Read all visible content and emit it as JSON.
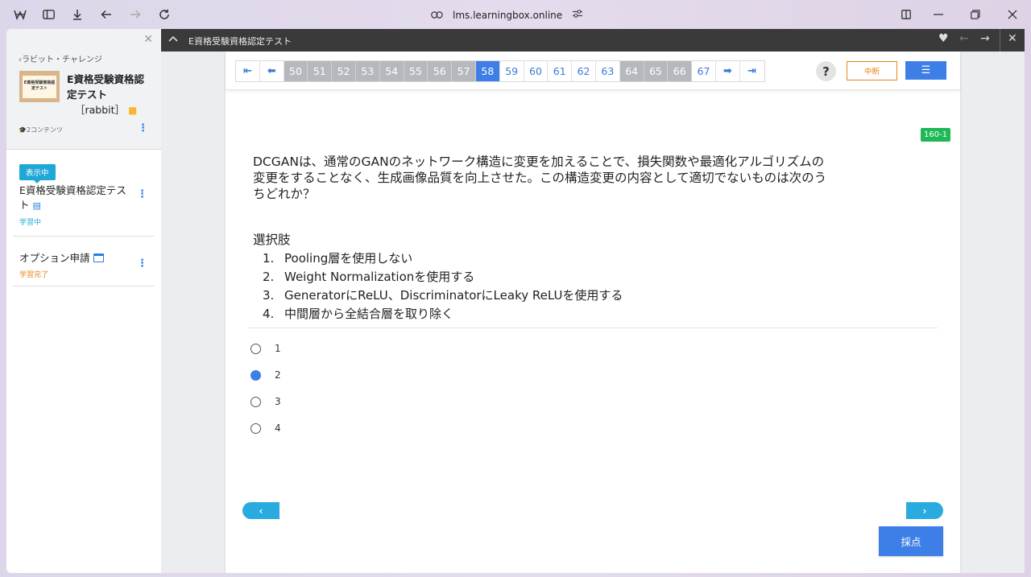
{
  "browser": {
    "url": "lms.learningbox.online"
  },
  "sidebar": {
    "back_link": "ラビット・チャレンジ",
    "thumbnail_text": "E資格受験資格認定テスト",
    "course_title": "E資格受験資格認定テスト",
    "course_tag": "［rabbit］",
    "content_count": "2コンテンツ",
    "current_badge": "表示中",
    "items": [
      {
        "title": "E資格受験資格認定テスト",
        "status": "学習中"
      },
      {
        "title": "オプション申請",
        "status": "学習完了"
      }
    ]
  },
  "topbar": {
    "title": "E資格受験資格認定テスト"
  },
  "pager": {
    "pages": [
      {
        "label": "50",
        "state": "answered"
      },
      {
        "label": "51",
        "state": "answered"
      },
      {
        "label": "52",
        "state": "answered"
      },
      {
        "label": "53",
        "state": "answered"
      },
      {
        "label": "54",
        "state": "answered"
      },
      {
        "label": "55",
        "state": "answered"
      },
      {
        "label": "56",
        "state": "answered"
      },
      {
        "label": "57",
        "state": "answered"
      },
      {
        "label": "58",
        "state": "current"
      },
      {
        "label": "59",
        "state": "unanswered"
      },
      {
        "label": "60",
        "state": "unanswered"
      },
      {
        "label": "61",
        "state": "unanswered"
      },
      {
        "label": "62",
        "state": "unanswered"
      },
      {
        "label": "63",
        "state": "unanswered"
      },
      {
        "label": "64",
        "state": "answered"
      },
      {
        "label": "65",
        "state": "answered"
      },
      {
        "label": "66",
        "state": "answered"
      },
      {
        "label": "67",
        "state": "unanswered"
      }
    ],
    "help": "?",
    "suspend": "中断"
  },
  "question": {
    "badge": "160-1",
    "text": "DCGANは、通常のGANのネットワーク構造に変更を加えることで、損失関数や最適化アルゴリズムの変更をすることなく、生成画像品質を向上させた。この構造変更の内容として適切でないものは次のうちどれか？",
    "choices_title": "選択肢",
    "choices": [
      "Pooling層を使用しない",
      "Weight Normalizationを使用する",
      "GeneratorにReLU、DiscriminatorにLeaky ReLUを使用する",
      "中間層から全結合層を取り除く"
    ],
    "options": [
      "1",
      "2",
      "3",
      "4"
    ],
    "selected": "2"
  },
  "buttons": {
    "prev": "‹",
    "next": "›",
    "grade": "採点"
  },
  "colors": {
    "accent": "#3d7fe6",
    "answered": "#b5b8bc",
    "badge_green": "#1db954",
    "suspend_orange": "#e8851a",
    "nav_cyan": "#29abe0"
  }
}
